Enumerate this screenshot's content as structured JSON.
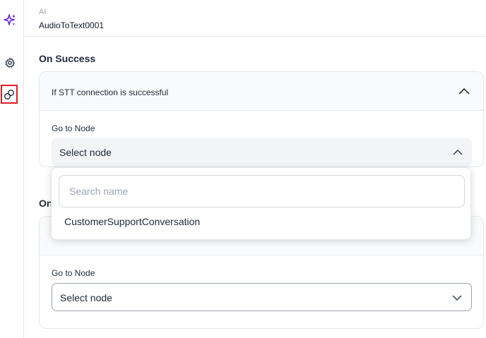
{
  "rail": {
    "items": [
      {
        "icon": "ai-sparkle-icon",
        "color": "#6d28d9"
      },
      {
        "icon": "gear-icon"
      },
      {
        "icon": "link-icon",
        "highlight": "#e11d24"
      }
    ]
  },
  "header": {
    "kicker": "AI",
    "name": "AudioToText0001"
  },
  "on_success": {
    "title": "On Success",
    "condition": "If STT connection is successful",
    "go_to_label": "Go to Node",
    "select_value": "Select node"
  },
  "dropdown": {
    "search_placeholder": "Search name",
    "options": [
      "CustomerSupportConversation"
    ]
  },
  "on_failure": {
    "title_visible": "On",
    "go_to_label": "Go to Node",
    "select_value": "Select node"
  }
}
